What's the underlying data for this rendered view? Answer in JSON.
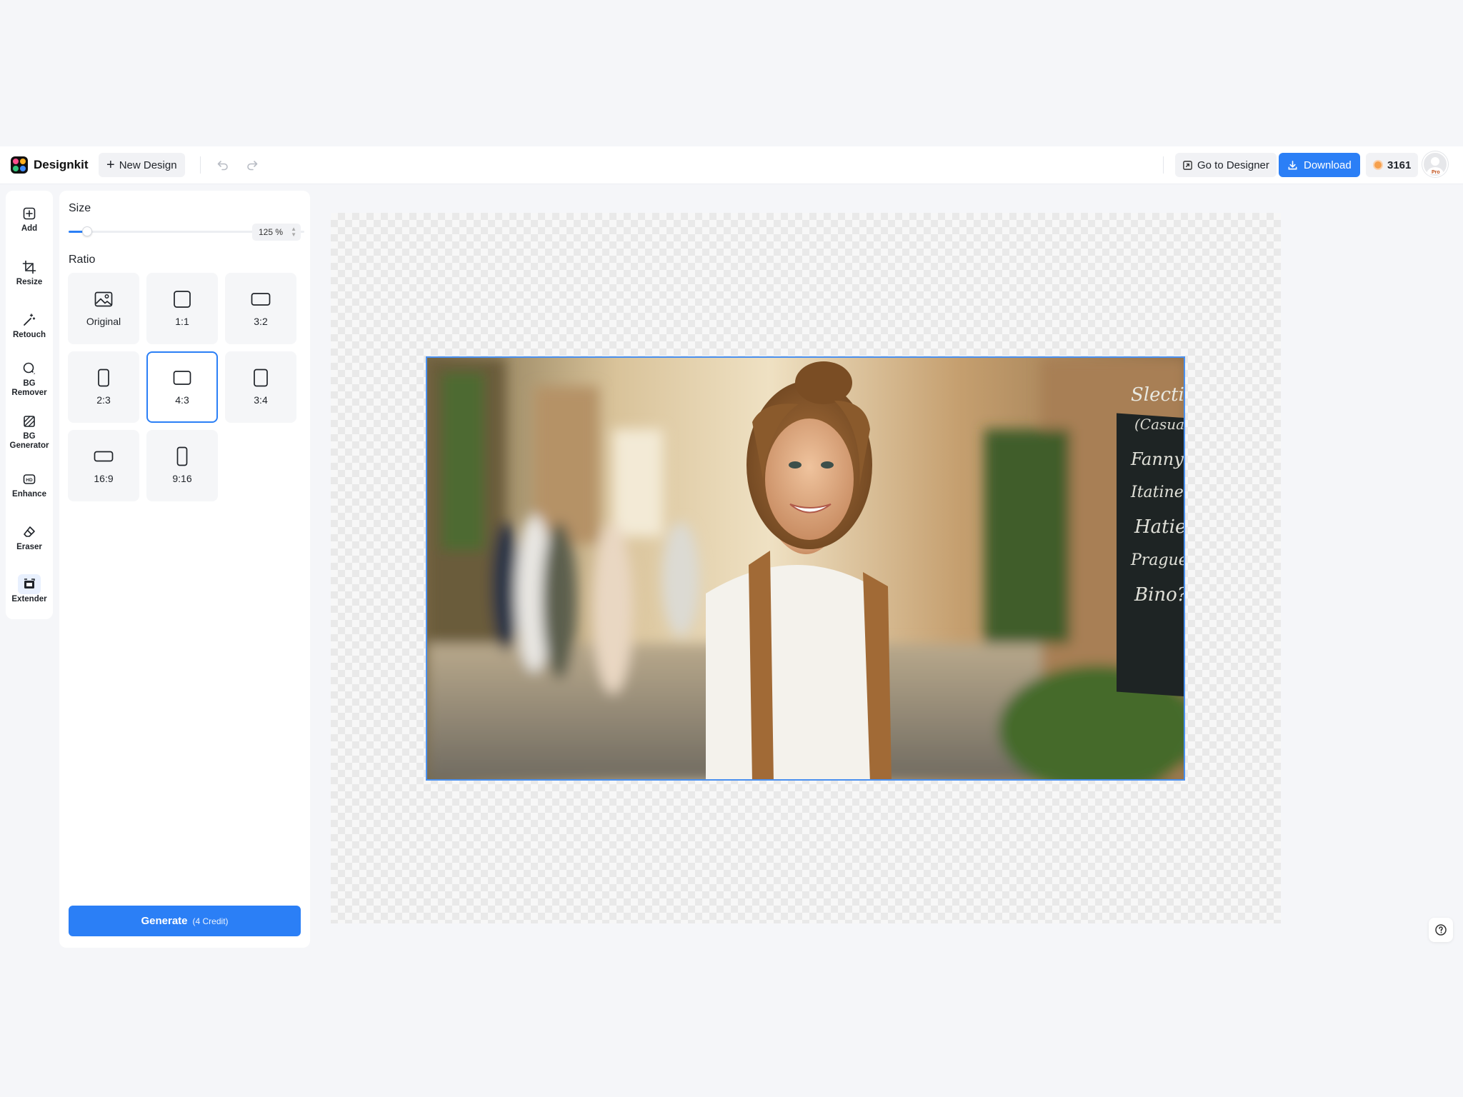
{
  "app": {
    "name": "Designkit",
    "new_design_label": "New Design"
  },
  "header": {
    "go_to_designer_label": "Go to Designer",
    "download_label": "Download",
    "credits": "3161",
    "avatar_badge": "Pro"
  },
  "tools": [
    {
      "label": "Add",
      "icon": "add-square-icon"
    },
    {
      "label": "Resize",
      "icon": "crop-icon"
    },
    {
      "label": "Retouch",
      "icon": "magic-wand-icon"
    },
    {
      "label": "BG Remover",
      "icon": "bg-remover-icon"
    },
    {
      "label": "BG Generator",
      "icon": "bg-generator-icon"
    },
    {
      "label": "Enhance",
      "icon": "hd-icon"
    },
    {
      "label": "Eraser",
      "icon": "eraser-icon"
    },
    {
      "label": "Extender",
      "icon": "extender-icon",
      "active": true
    }
  ],
  "panel": {
    "size_title": "Size",
    "size_value_text": "125 %",
    "size_slider_fraction": 0.08,
    "ratio_title": "Ratio",
    "ratios": [
      {
        "label": "Original",
        "icon": "image-icon"
      },
      {
        "label": "1:1",
        "icon": "ratio-square-icon"
      },
      {
        "label": "3:2",
        "icon": "ratio-landscape-icon"
      },
      {
        "label": "2:3",
        "icon": "ratio-portrait-icon"
      },
      {
        "label": "4:3",
        "icon": "ratio-landscape-icon",
        "selected": true
      },
      {
        "label": "3:4",
        "icon": "ratio-portrait-icon"
      },
      {
        "label": "16:9",
        "icon": "ratio-wide-icon"
      },
      {
        "label": "9:16",
        "icon": "ratio-tall-icon"
      }
    ],
    "generate_label": "Generate",
    "generate_credit": "(4 Credit)"
  },
  "colors": {
    "accent": "#2b7ff6",
    "page_bg": "#f5f6f9"
  }
}
